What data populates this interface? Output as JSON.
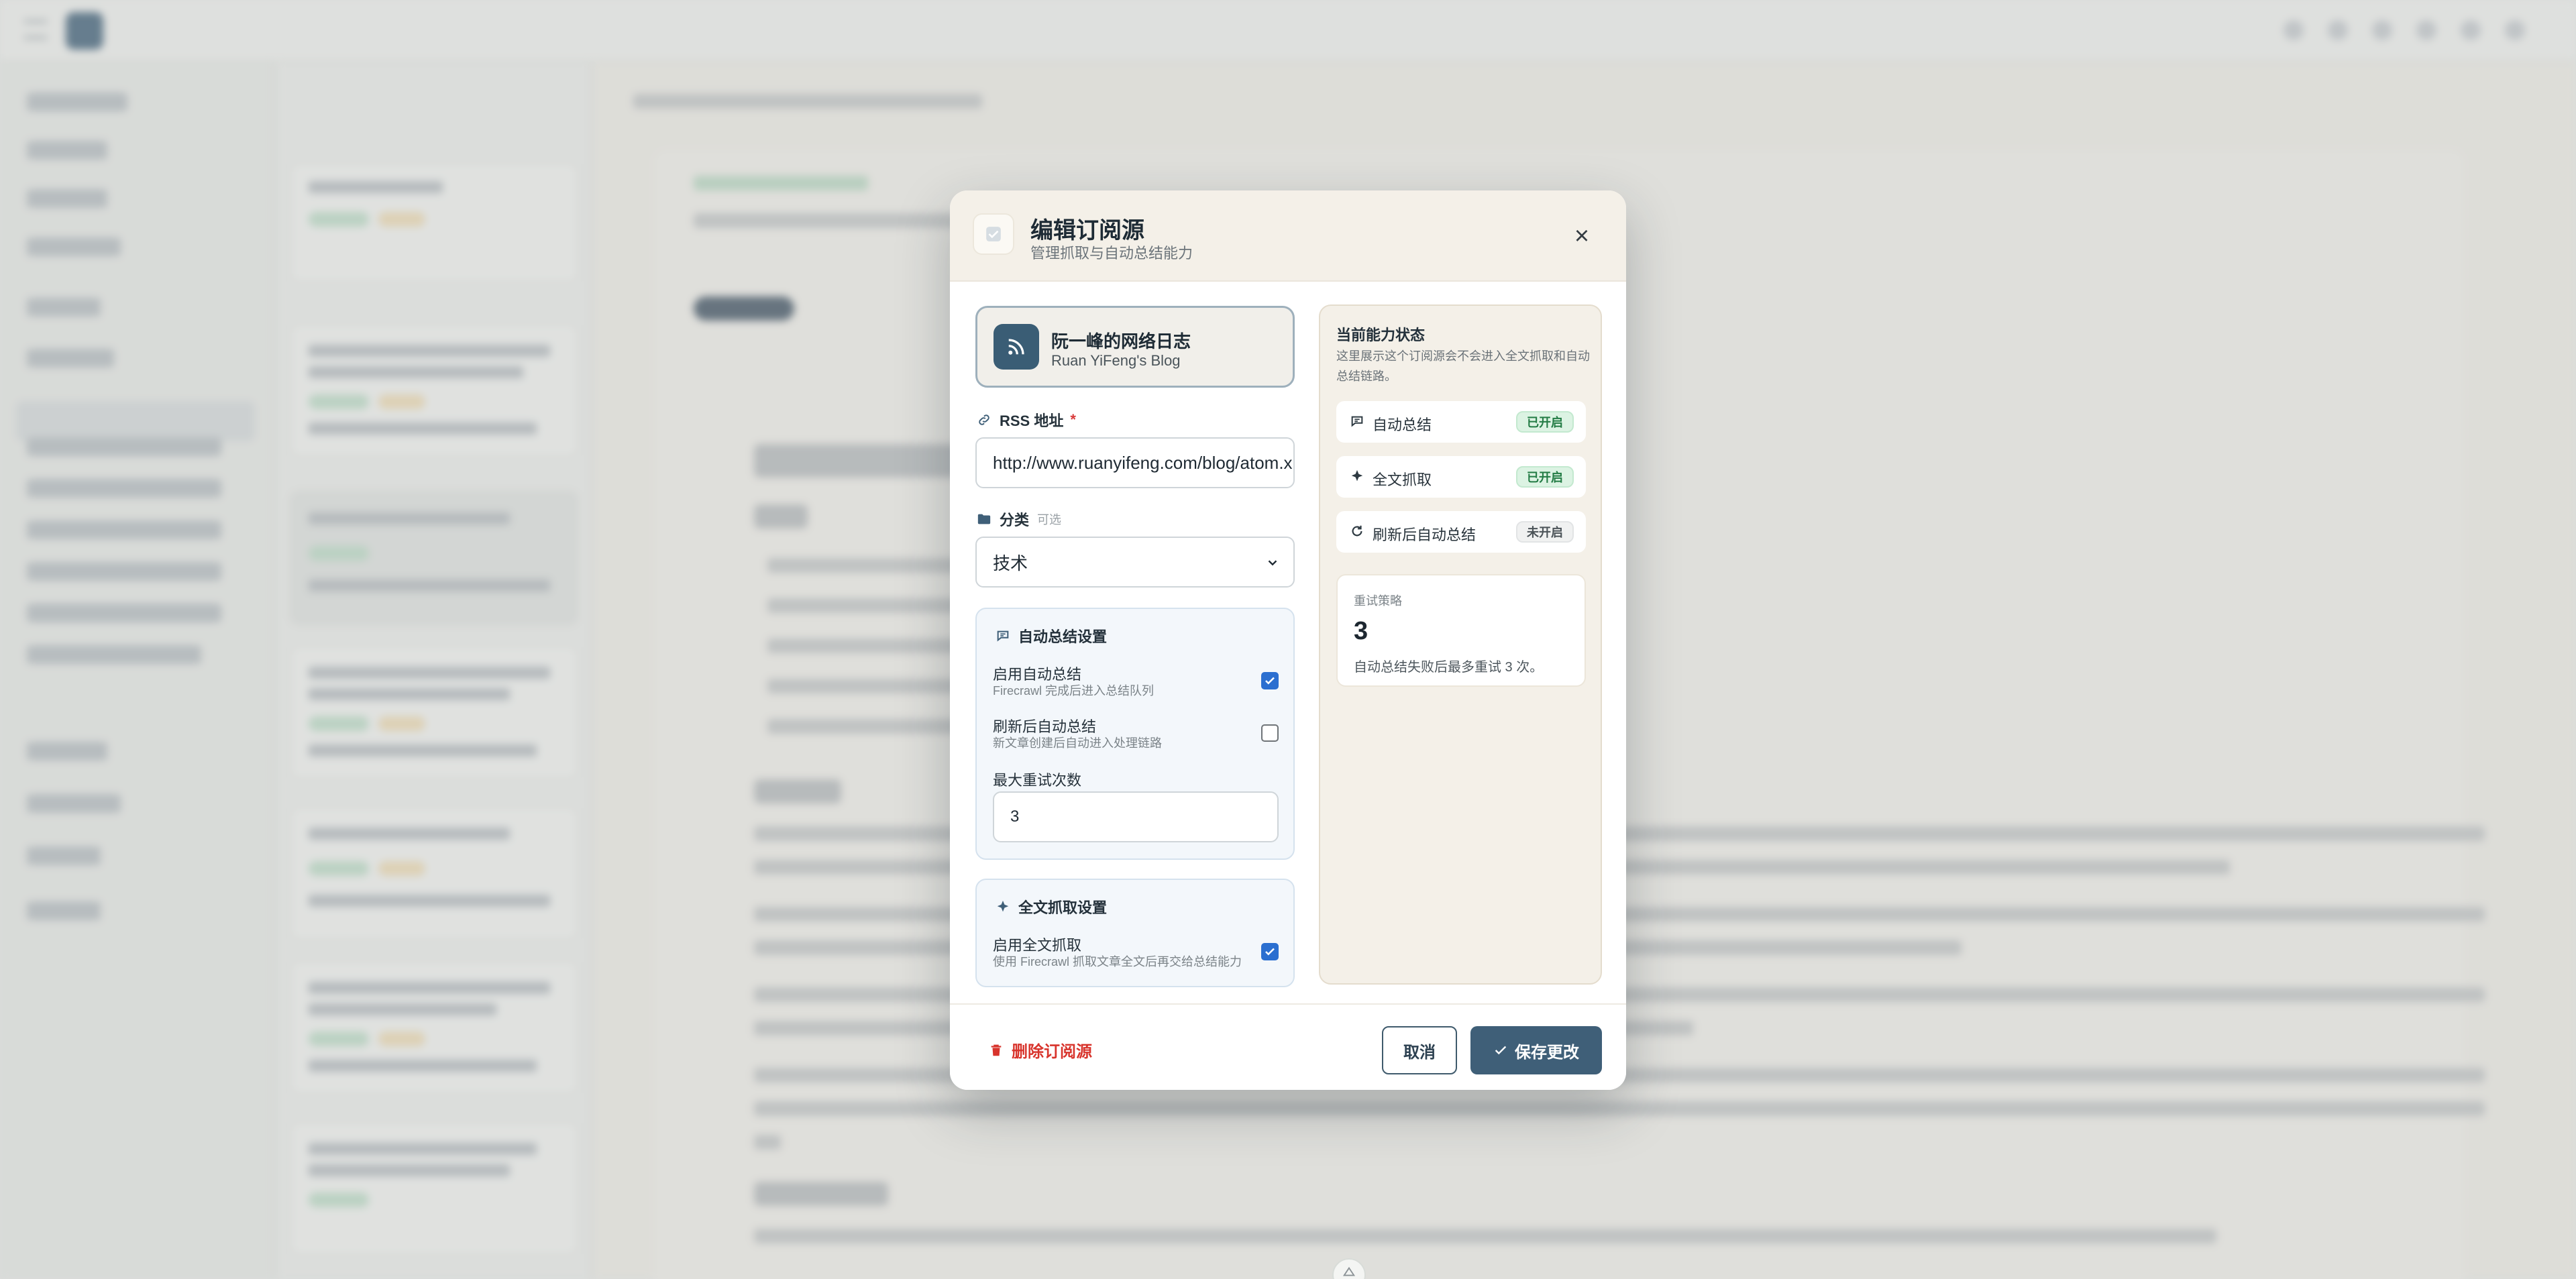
{
  "modal": {
    "title": "编辑订阅源",
    "subtitle": "管理抓取与自动总结能力",
    "close_glyph": "×"
  },
  "feed": {
    "name": "阮一峰的网络日志",
    "subtitle": "Ruan YiFeng's Blog",
    "icon": "rss-icon"
  },
  "form": {
    "rss_label": "RSS 地址",
    "rss_required_mark": "*",
    "rss_value": "http://www.ruanyifeng.com/blog/atom.xml",
    "category_label": "分类",
    "category_optional": "可选",
    "category_value": "技术"
  },
  "summary_settings": {
    "title": "自动总结设置",
    "enable_label": "启用自动总结",
    "enable_hint": "Firecrawl 完成后进入总结队列",
    "enable_checked": true,
    "refresh_label": "刷新后自动总结",
    "refresh_hint": "新文章创建后自动进入处理链路",
    "refresh_checked": false,
    "retry_label": "最大重试次数",
    "retry_value": "3"
  },
  "fulltext_settings": {
    "title": "全文抓取设置",
    "enable_label": "启用全文抓取",
    "enable_hint": "使用 Firecrawl 抓取文章全文后再交给总结能力",
    "enable_checked": true
  },
  "status_panel": {
    "title": "当前能力状态",
    "description": "这里展示这个订阅源会不会进入全文抓取和自动总结链路。",
    "capabilities": [
      {
        "label": "自动总结",
        "status": "已开启",
        "enabled": true,
        "icon": "summary-icon"
      },
      {
        "label": "全文抓取",
        "status": "已开启",
        "enabled": true,
        "icon": "sparkle-icon"
      },
      {
        "label": "刷新后自动总结",
        "status": "未开启",
        "enabled": false,
        "icon": "refresh-icon"
      }
    ],
    "retry_card": {
      "label": "重试策略",
      "value": "3",
      "description": "自动总结失败后最多重试 3 次。"
    }
  },
  "footer": {
    "delete_label": "删除订阅源",
    "cancel_label": "取消",
    "save_label": "保存更改"
  },
  "colors": {
    "accent": "#3f5f78",
    "danger": "#d8342c",
    "enabled_badge": "#237c45",
    "checkbox": "#2b6fd0"
  }
}
